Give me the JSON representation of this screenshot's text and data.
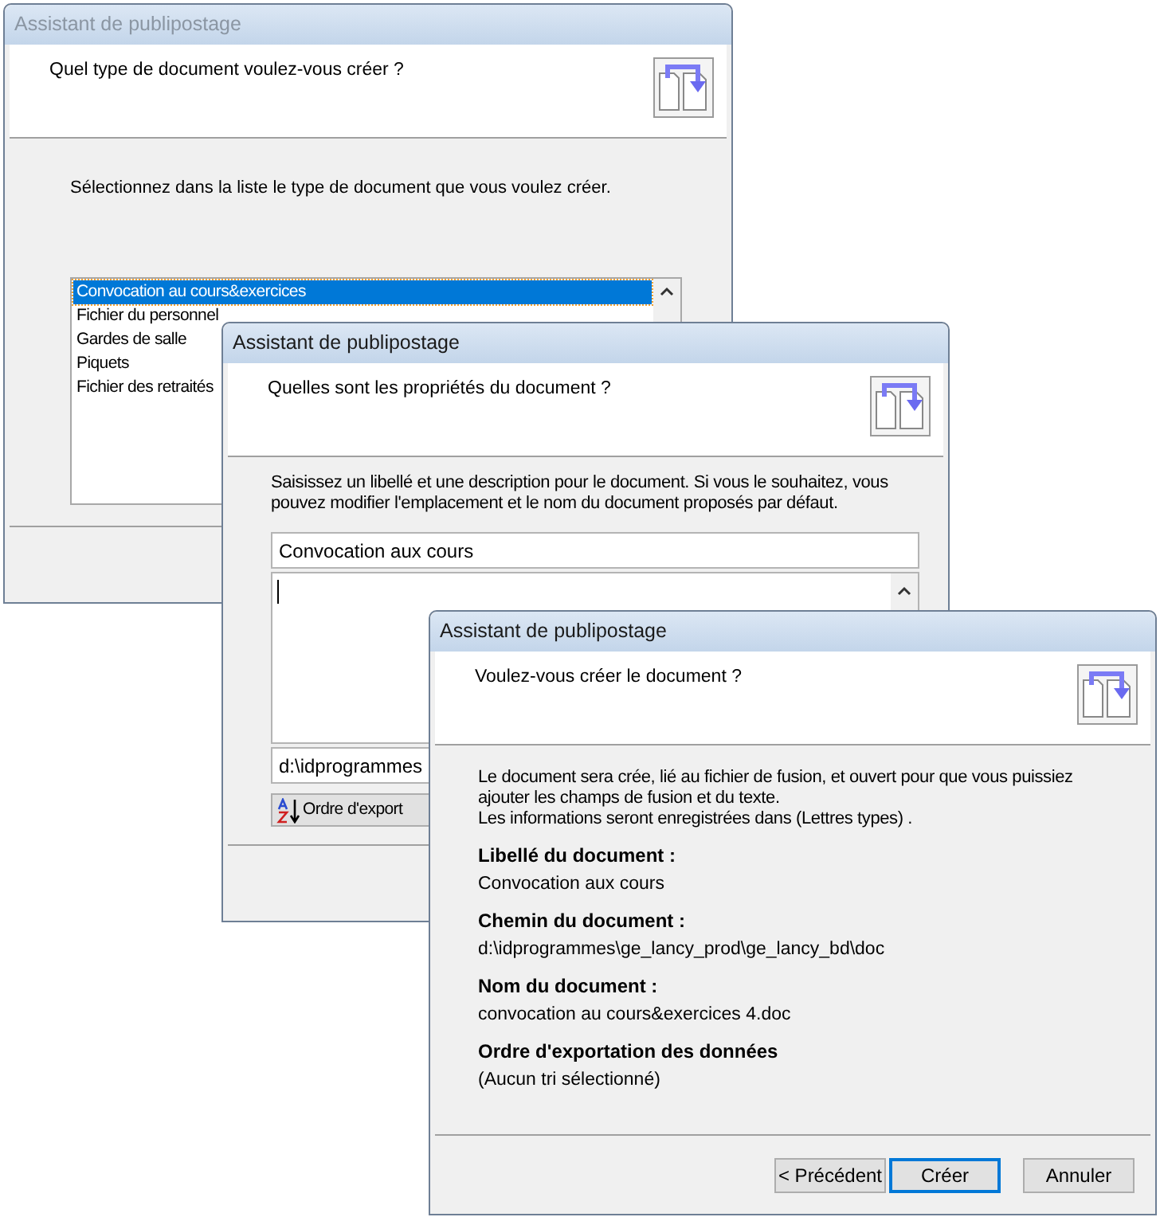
{
  "windows": [
    {
      "kind": "type",
      "title": "Assistant de publipostage",
      "active": false,
      "question": "Quel type de document voulez-vous créer ?",
      "instruction": "Sélectionnez dans la liste le type de document que vous voulez créer.",
      "items": [
        {
          "label": "Convocation au cours&exercices",
          "selected": true
        },
        {
          "label": "Fichier du personnel",
          "selected": false
        },
        {
          "label": "Gardes de salle",
          "selected": false
        },
        {
          "label": "Piquets",
          "selected": false
        },
        {
          "label": "Fichier des retraités",
          "selected": false
        }
      ]
    },
    {
      "kind": "properties",
      "title": "Assistant de publipostage",
      "active": true,
      "question": "Quelles sont les propriétés du document ?",
      "instruction": "Saisissez un libellé et une description pour le document. Si vous le souhaitez, vous pouvez modifier l'emplacement et le nom du document proposés par défaut.",
      "label_value": "Convocation aux cours",
      "path_value": "d:\\idprogrammes",
      "sort_button": "Ordre d'export"
    },
    {
      "kind": "summary",
      "title": "Assistant de publipostage",
      "active": true,
      "question": "Voulez-vous créer le document ?",
      "intro": [
        "Le document sera crée, lié au fichier de fusion, et ouvert pour que vous puissiez ajouter les champs de fusion et du texte.",
        "Les informations seront enregistrées dans (Lettres types) ."
      ],
      "sections": [
        {
          "heading": "Libellé du document :",
          "value": "Convocation aux cours"
        },
        {
          "heading": "Chemin du document :",
          "value": "d:\\idprogrammes\\ge_lancy_prod\\ge_lancy_bd\\doc"
        },
        {
          "heading": "Nom du document :",
          "value": "convocation au cours&exercices 4.doc"
        },
        {
          "heading": "Ordre d'exportation des données",
          "value": "(Aucun tri sélectionné)"
        }
      ],
      "buttons": [
        {
          "label": "< Précédent",
          "default": false
        },
        {
          "label": "Créer",
          "default": true
        },
        {
          "label": "Annuler",
          "default": false
        }
      ]
    }
  ]
}
